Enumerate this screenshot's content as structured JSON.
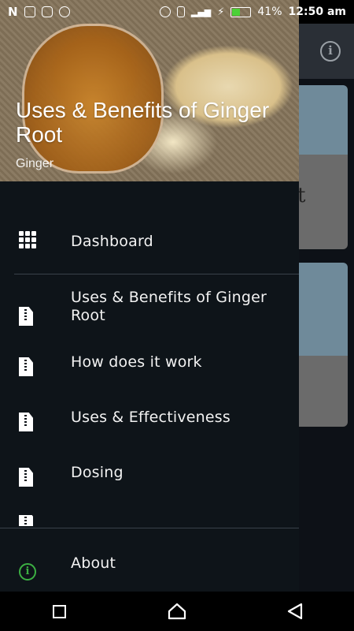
{
  "status_bar": {
    "left_icons": [
      "n-icon",
      "image-icon",
      "instagram-icon",
      "sync-icon"
    ],
    "n_label": "N",
    "battery_percent": "41%",
    "time": "12:50 am",
    "right_icons": [
      "hotspot-icon",
      "vibrate-icon",
      "signal-icon",
      "charging-icon",
      "battery-icon"
    ]
  },
  "drawer": {
    "header": {
      "title": "Uses & Benefits of Ginger Root",
      "subtitle": "Ginger"
    },
    "items": [
      {
        "label": "Dashboard",
        "icon": "grid-icon"
      },
      {
        "label": "Uses & Benefits of Ginger Root",
        "icon": "zip-file-icon"
      },
      {
        "label": "How does it work",
        "icon": "zip-file-icon"
      },
      {
        "label": "Uses & Effectiveness",
        "icon": "zip-file-icon"
      },
      {
        "label": "Dosing",
        "icon": "zip-file-icon"
      }
    ],
    "about": {
      "label": "About",
      "icon": "info-icon",
      "color": "#3cb043"
    }
  },
  "background_app": {
    "toolbar_icon": "info-icon",
    "visible_letter": "t"
  },
  "nav_bar": {
    "buttons": [
      "recents-button",
      "home-button",
      "back-button"
    ]
  },
  "colors": {
    "drawer_bg": "#0e1419",
    "about_accent": "#3cb043"
  }
}
